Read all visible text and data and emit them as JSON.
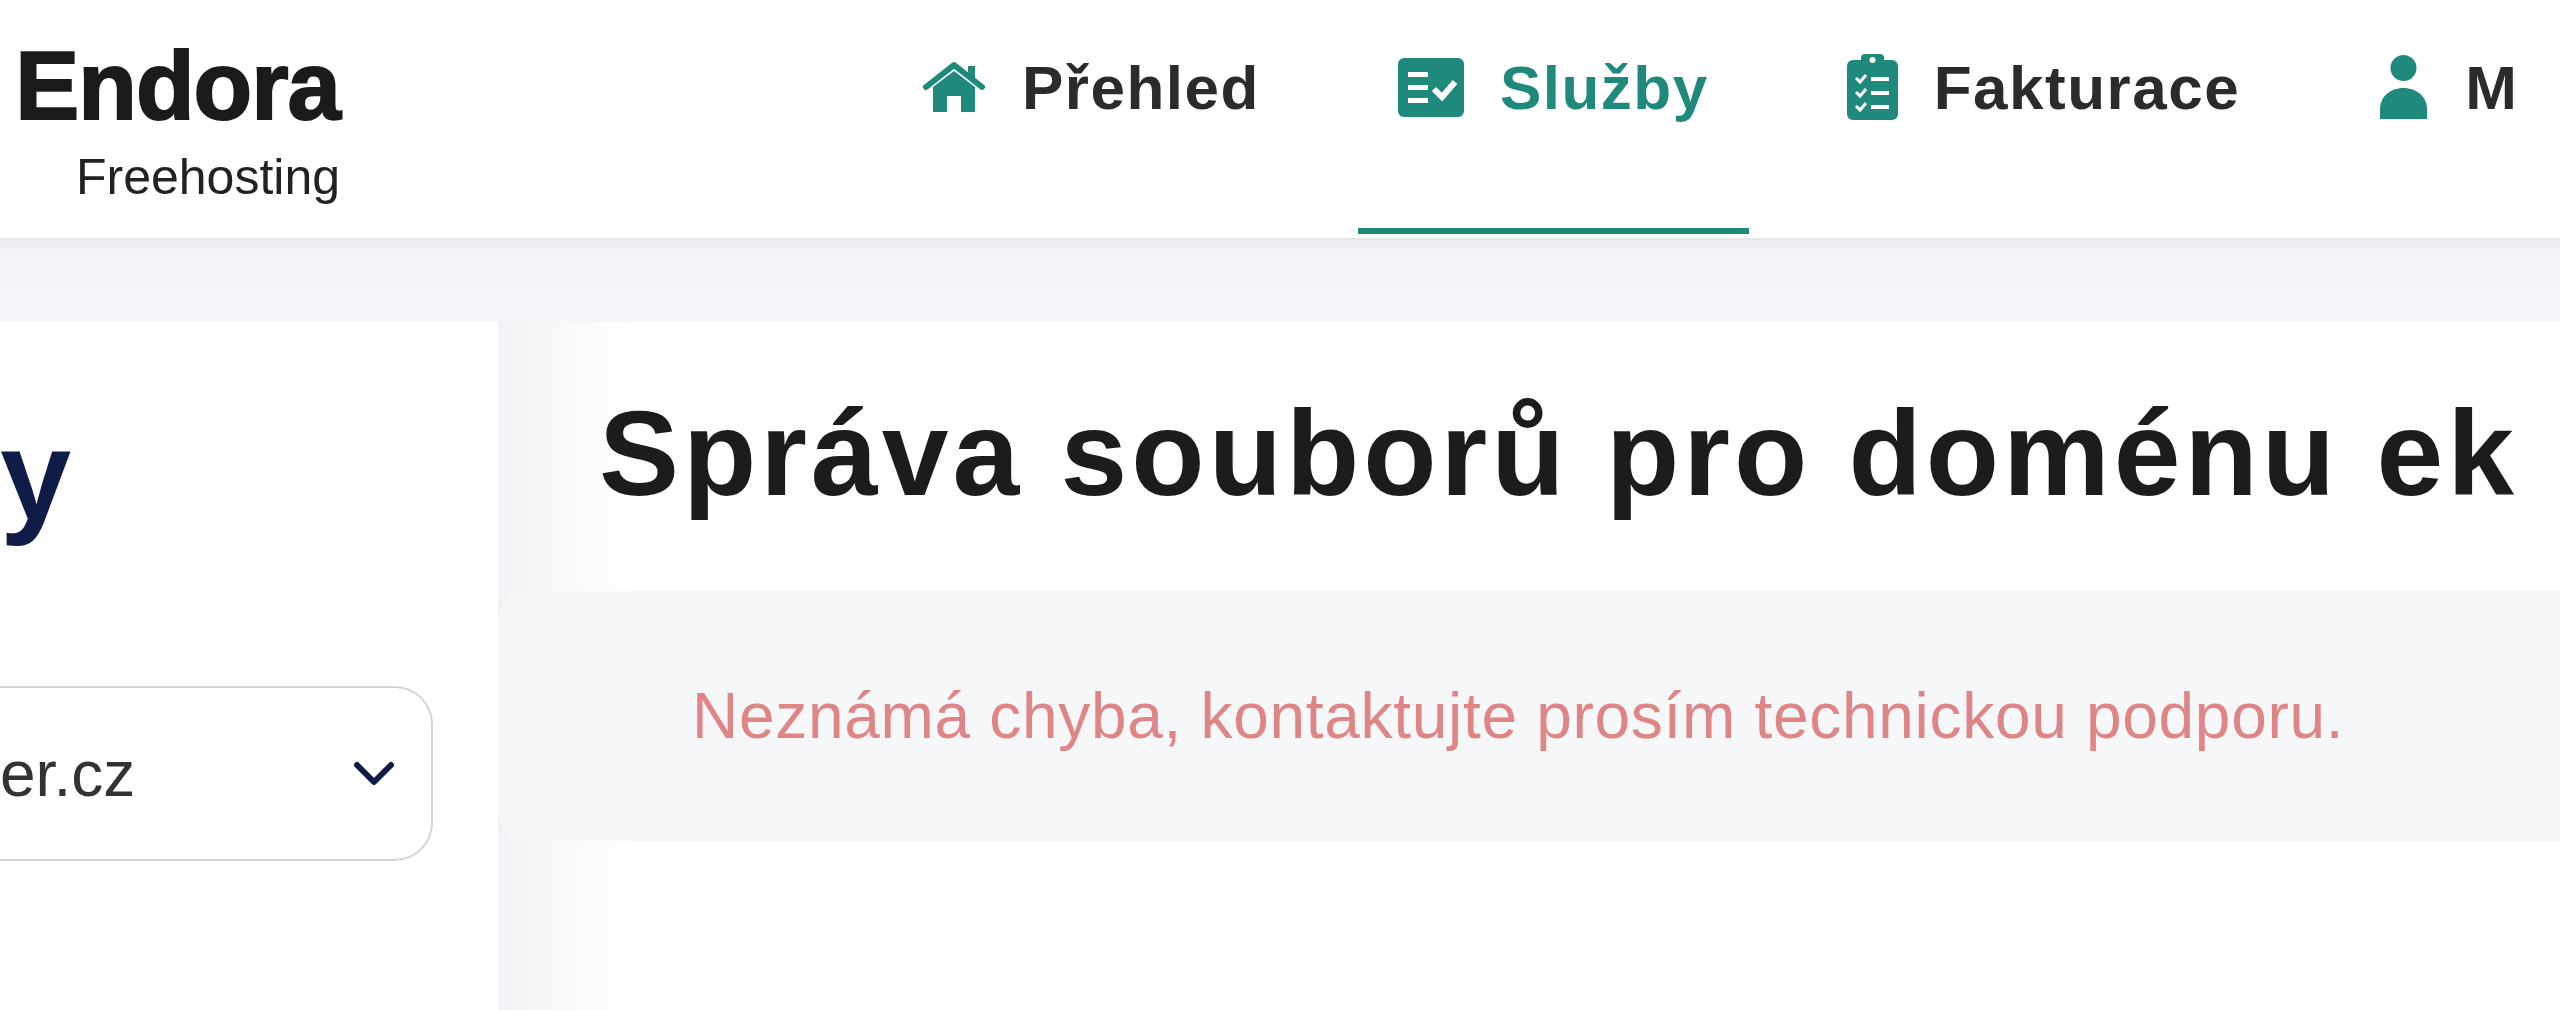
{
  "logo": {
    "name": "Endora",
    "tagline": "Freehosting"
  },
  "nav": {
    "tabs": [
      {
        "label": "Přehled",
        "selected": false
      },
      {
        "label": "Služby",
        "selected": true
      },
      {
        "label": "Fakturace",
        "selected": false
      },
      {
        "label": "M",
        "selected": false
      }
    ]
  },
  "sidebar": {
    "title": "y",
    "domain_select": {
      "value": "er.cz"
    }
  },
  "main": {
    "title": "Správa souborů pro doménu ek",
    "alert": {
      "kind": "error",
      "message": "Neznámá chyba, kontaktujte prosím technickou podporu."
    }
  }
}
